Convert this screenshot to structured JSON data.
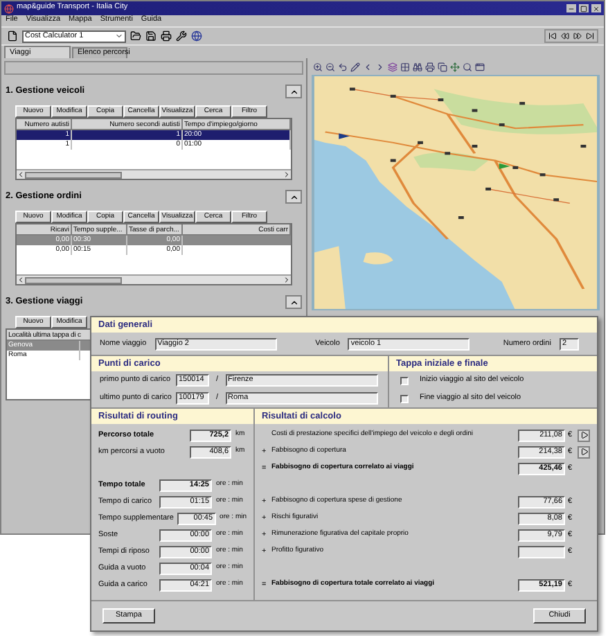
{
  "window": {
    "title": "map&guide Transport - Italia City"
  },
  "menu": [
    "File",
    "Visualizza",
    "Mappa",
    "Strumenti",
    "Guida"
  ],
  "toolbar": {
    "combo": "Cost Calculator 1"
  },
  "tabs": [
    {
      "label": "Viaggi",
      "selected": true
    },
    {
      "label": "Elenco percorsi",
      "selected": false
    }
  ],
  "sections": [
    {
      "title": "1. Gestione veicoli",
      "buttons": [
        "Nuovo",
        "Modifica",
        "Copia",
        "Cancella",
        "Visualizza",
        "Cerca",
        "Filtro"
      ],
      "columns": [
        "Numero autisti",
        "Numero secondi autisti",
        "Tempo d'impiego/giorno"
      ],
      "rows": [
        {
          "cells": [
            "1",
            "1",
            "20:00"
          ],
          "selected": true
        },
        {
          "cells": [
            "1",
            "0",
            "01:00"
          ],
          "selected": false
        }
      ]
    },
    {
      "title": "2. Gestione ordini",
      "buttons": [
        "Nuovo",
        "Modifica",
        "Copia",
        "Cancella",
        "Visualizza",
        "Cerca",
        "Filtro"
      ],
      "columns": [
        "Ricavi",
        "Tempo supple...",
        "Tasse di parch...",
        "Costi carr"
      ],
      "rows": [
        {
          "cells": [
            "0,00",
            "00:30",
            "0,00"
          ],
          "selected": true
        },
        {
          "cells": [
            "0,00",
            "00:15",
            "0,00"
          ],
          "selected": false
        }
      ]
    },
    {
      "title": "3. Gestione viaggi",
      "buttons": [
        "Nuovo",
        "Modifica"
      ],
      "columns": [
        "Località ultima tappa di c"
      ],
      "rows": [
        {
          "cells": [
            "Genova"
          ],
          "selected": true
        },
        {
          "cells": [
            "Roma"
          ],
          "selected": false
        }
      ]
    }
  ],
  "dialog": {
    "general": {
      "title": "Dati generali",
      "fields": [
        {
          "label": "Nome viaggio",
          "value": "Viaggio 2"
        },
        {
          "label": "Veicolo",
          "value": "veicolo 1"
        },
        {
          "label": "Numero ordini",
          "value": "2"
        }
      ]
    },
    "loading": {
      "title": "Punti di carico",
      "rows": [
        {
          "label": "primo punto di carico",
          "code": "150014",
          "separator": "/",
          "place": "Firenze"
        },
        {
          "label": "ultimo punto di carico",
          "code": "100179",
          "separator": "/",
          "place": "Roma"
        }
      ]
    },
    "stops": {
      "title": "Tappa iniziale e finale",
      "options": [
        {
          "label": "Inizio viaggio al sito del veicolo",
          "checked": false
        },
        {
          "label": "Fine viaggio al sito del veicolo",
          "checked": false
        }
      ]
    },
    "routing": {
      "title": "Risultati di routing",
      "groups": [
        [
          {
            "label": "Percorso totale",
            "value": "725,2",
            "unit": "km",
            "bold": true
          },
          {
            "label": "km percorsi a vuoto",
            "value": "408,6",
            "unit": "km",
            "bold": false
          }
        ],
        [
          {
            "label": "Tempo totale",
            "value": "14:25",
            "unit": "ore : min",
            "bold": true
          },
          {
            "label": "Tempo di carico",
            "value": "01:15",
            "unit": "ore : min",
            "bold": false
          },
          {
            "label": "Tempo supplementare",
            "value": "00:45",
            "unit": "ore : min",
            "bold": false
          },
          {
            "label": "Soste",
            "value": "00:00",
            "unit": "ore : min",
            "bold": false
          },
          {
            "label": "Tempi di riposo",
            "value": "00:00",
            "unit": "ore : min",
            "bold": false
          },
          {
            "label": "Guida a vuoto",
            "value": "00:04",
            "unit": "ore : min",
            "bold": false
          },
          {
            "label": "Guida a carico",
            "value": "04:21",
            "unit": "ore : min",
            "bold": false
          }
        ]
      ]
    },
    "calc": {
      "title": "Risultati di calcolo",
      "groups": [
        [
          {
            "label": "Costi di prestazione specifici dell'impiego del veicolo e degli ordini",
            "value": "211,08",
            "unit": "€",
            "bold": false,
            "arrow": true
          },
          {
            "sign": "+",
            "label": "Fabbisogno di copertura",
            "value": "214,38",
            "unit": "€",
            "bold": false,
            "arrow": true
          },
          {
            "sign": "=",
            "label": "Fabbisogno di copertura correlato ai viaggi",
            "value": "425,46",
            "unit": "€",
            "bold": true,
            "arrow": false
          }
        ],
        [
          {
            "sign": "+",
            "label": "Fabbisogno di copertura spese di gestione",
            "value": "77,66",
            "unit": "€",
            "bold": false,
            "arrow": false
          },
          {
            "sign": "+",
            "label": "Rischi figurativi",
            "value": "8,08",
            "unit": "€",
            "bold": false,
            "arrow": false
          },
          {
            "sign": "+",
            "label": "Rimunerazione figurativa del capitale proprio",
            "value": "9,79",
            "unit": "€",
            "bold": false,
            "arrow": false
          },
          {
            "sign": "+",
            "label": "Profitto figurativo",
            "unit": "€",
            "bold": false,
            "arrow": false
          }
        ],
        [
          {
            "sign": "=",
            "label": "Fabbisogno di copertura totale correlato ai viaggi",
            "value": "521,19",
            "unit": "€",
            "bold": true,
            "arrow": false
          }
        ]
      ]
    },
    "buttons": [
      "Stampa",
      "Chiudi"
    ]
  }
}
